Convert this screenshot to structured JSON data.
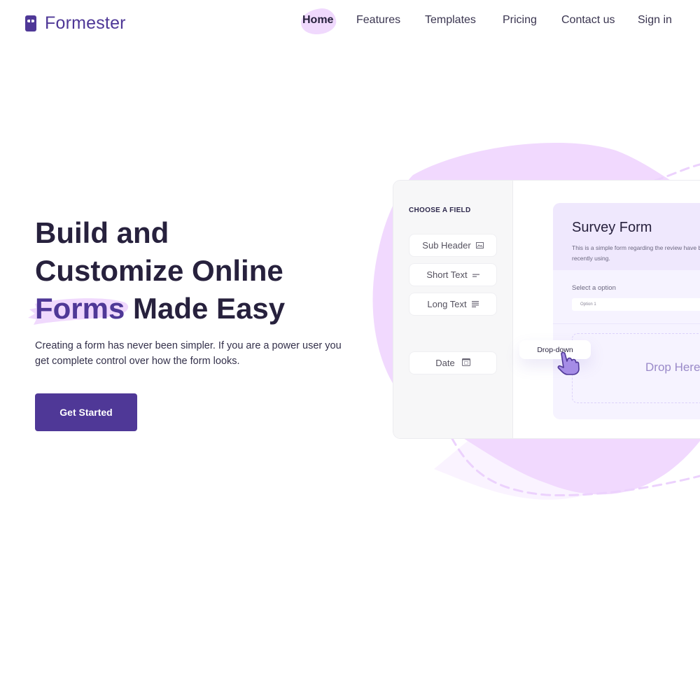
{
  "brand": {
    "name": "Formester",
    "logo_icon": "mask-logo-icon",
    "accent_color": "#4f3897",
    "highlight_color": "#f0d9fd"
  },
  "nav": {
    "items": [
      {
        "label": "Home",
        "active": true
      },
      {
        "label": "Features",
        "active": false
      },
      {
        "label": "Templates",
        "active": false
      },
      {
        "label": "Pricing",
        "active": false
      },
      {
        "label": "Contact us",
        "active": false
      },
      {
        "label": "Sign in",
        "active": false
      }
    ]
  },
  "hero": {
    "title_line1": "Build and",
    "title_line2": "Customize Online",
    "title_accent": "Forms",
    "title_rest": " Made Easy",
    "description": "Creating a form has never been simpler. If you are a power user you get complete control over how the form looks.",
    "cta_label": "Get Started"
  },
  "builder": {
    "panel_title": "CHOOSE A FIELD",
    "fields": [
      {
        "label": "Sub Header",
        "icon": "image-icon"
      },
      {
        "label": "Short Text",
        "icon": "short-text-icon"
      },
      {
        "label": "Long Text",
        "icon": "long-text-icon"
      },
      {
        "label": "Date",
        "icon": "calendar-icon"
      }
    ],
    "dragging_field": "Drop-down",
    "cursor_icon": "hand-pointer-icon",
    "form": {
      "title": "Survey Form",
      "description": "This is a simple form regarding the review have been recently using.",
      "select_label": "Select a option",
      "select_value": "Option 1",
      "drop_zone_text": "Drop Here"
    }
  }
}
